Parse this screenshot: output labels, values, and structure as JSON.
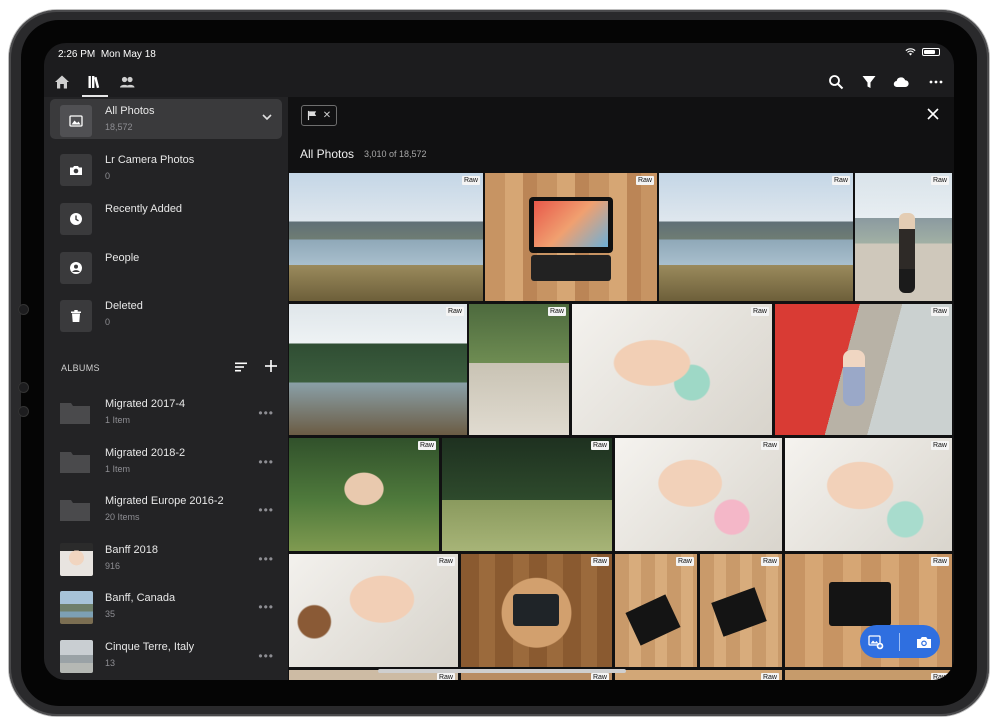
{
  "status": {
    "time": "2:26 PM",
    "date": "Mon May 18"
  },
  "sources": [
    {
      "title": "All Photos",
      "count": "18,572"
    },
    {
      "title": "Lr Camera Photos",
      "count": "0"
    },
    {
      "title": "Recently Added",
      "count": ""
    },
    {
      "title": "People",
      "count": ""
    },
    {
      "title": "Deleted",
      "count": "0"
    }
  ],
  "albums_heading": "ALBUMS",
  "albums": [
    {
      "title": "Migrated 2017-4",
      "count": "1 Item"
    },
    {
      "title": "Migrated 2018-2",
      "count": "1 Item"
    },
    {
      "title": "Migrated Europe 2016-2",
      "count": "20 Items"
    },
    {
      "title": "Banff 2018",
      "count": "916"
    },
    {
      "title": "Banff, Canada",
      "count": "35"
    },
    {
      "title": "Cinque Terre, Italy",
      "count": "13"
    }
  ],
  "grid": {
    "title": "All Photos",
    "count": "3,010 of 18,572",
    "raw_badge": "Raw"
  },
  "icons": [
    "home-icon",
    "library-icon",
    "people-icon",
    "search-icon",
    "filter-icon",
    "cloud-icon",
    "more-icon",
    "flag-icon",
    "close-icon",
    "add-photo-icon",
    "camera-icon"
  ],
  "colors": {
    "accent": "#2f6fe0",
    "sidebar": "#232325",
    "grid_bg": "#111112"
  }
}
